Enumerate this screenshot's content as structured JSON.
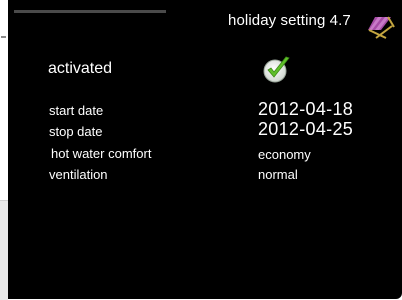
{
  "header": {
    "title": "holiday setting 4.7",
    "icon": "deck-chair-icon"
  },
  "status": {
    "label": "activated",
    "checked": true,
    "icon": "checkmark-icon"
  },
  "settings": [
    {
      "label": "start date",
      "value": "2012-04-18"
    },
    {
      "label": "stop date",
      "value": "2012-04-25"
    },
    {
      "label": "hot water comfort",
      "value": "economy"
    },
    {
      "label": "ventilation",
      "value": "normal"
    }
  ],
  "colors": {
    "background": "#000000",
    "text": "#ffffff",
    "check_green": "#5fbf2a",
    "chair_purple": "#a64ca6"
  }
}
